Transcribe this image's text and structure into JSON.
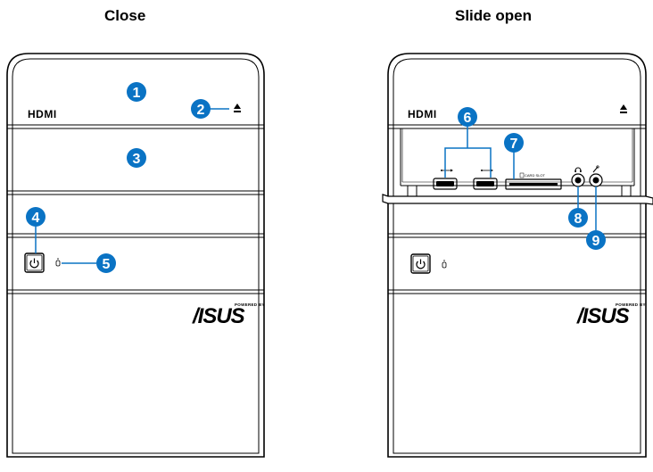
{
  "panels": {
    "close": {
      "title": "Close"
    },
    "open": {
      "title": "Slide open"
    }
  },
  "front_panel": {
    "hdmi_label": "HDMI",
    "logo_text": "/ISUS",
    "powered_by": "POWERED BY",
    "card_slot_label": "CARD SLOT"
  },
  "callouts": [
    "1",
    "2",
    "3",
    "4",
    "5",
    "6",
    "7",
    "8",
    "9"
  ],
  "colors": {
    "callout": "#0a73c4",
    "line": "#000000",
    "background": "#ffffff"
  },
  "icons": [
    "eject-icon",
    "power-icon",
    "hdd-led-icon",
    "usb-icon",
    "headphone-icon",
    "microphone-icon"
  ]
}
